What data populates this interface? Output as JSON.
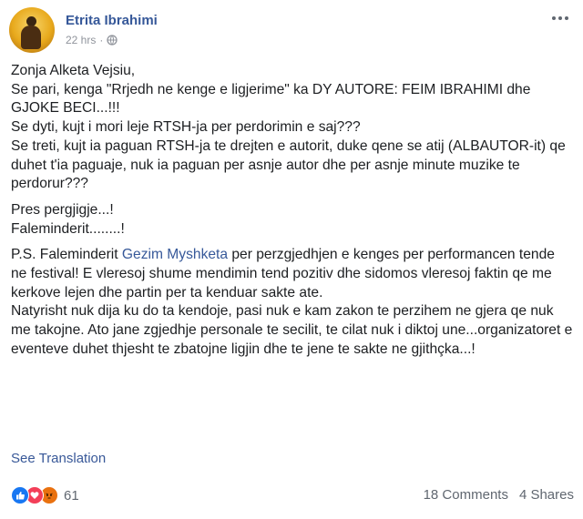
{
  "author": {
    "name": "Etrita Ibrahimi",
    "time": "22 hrs",
    "time_sep": "·",
    "privacy_icon": "globe-icon"
  },
  "post": {
    "p1": "Zonja Alketa Vejsiu,\nSe pari, kenga \"Rrjedh ne kenge e ligjerime\" ka DY AUTORE: FEIM IBRAHIMI dhe GJOKE BECI...!!!\nSe dyti, kujt i mori leje RTSH-ja per perdorimin e saj???\nSe treti, kujt ia paguan RTSH-ja te drejten e autorit, duke qene se atij (ALBAUTOR-it) qe duhet t'ia paguaje, nuk ia paguan per asnje autor dhe per asnje minute muzike te perdorur???",
    "p2": "Pres pergjigje...!\nFaleminderit........!",
    "p3_before": "P.S. Faleminderit ",
    "p3_link": "Gezim Myshketa",
    "p3_after": " per perzgjedhjen e kenges per performancen tende ne festival! E vleresoj shume mendimin tend pozitiv dhe sidomos vleresoj faktin qe me kerkove lejen dhe partin per ta kenduar sakte ate.\nNatyrisht nuk dija ku do ta kendoje, pasi nuk e kam zakon te perzihem ne gjera qe nuk me takojne. Ato jane zgjedhje personale te secilit, te cilat nuk i diktoj une...organizatoret e eventeve duhet thjesht te zbatojne ligjin dhe te jene te sakte ne gjithçka...!"
  },
  "see_translation": "See Translation",
  "reactions": {
    "icons": [
      "like-icon",
      "love-icon",
      "angry-icon"
    ],
    "count": "61"
  },
  "stats": {
    "comments": "18 Comments",
    "shares": "4 Shares"
  },
  "colors": {
    "link": "#365899",
    "meta": "#90949c",
    "like": "#1877f2",
    "love": "#f33e58",
    "angry": "#e9710f"
  }
}
